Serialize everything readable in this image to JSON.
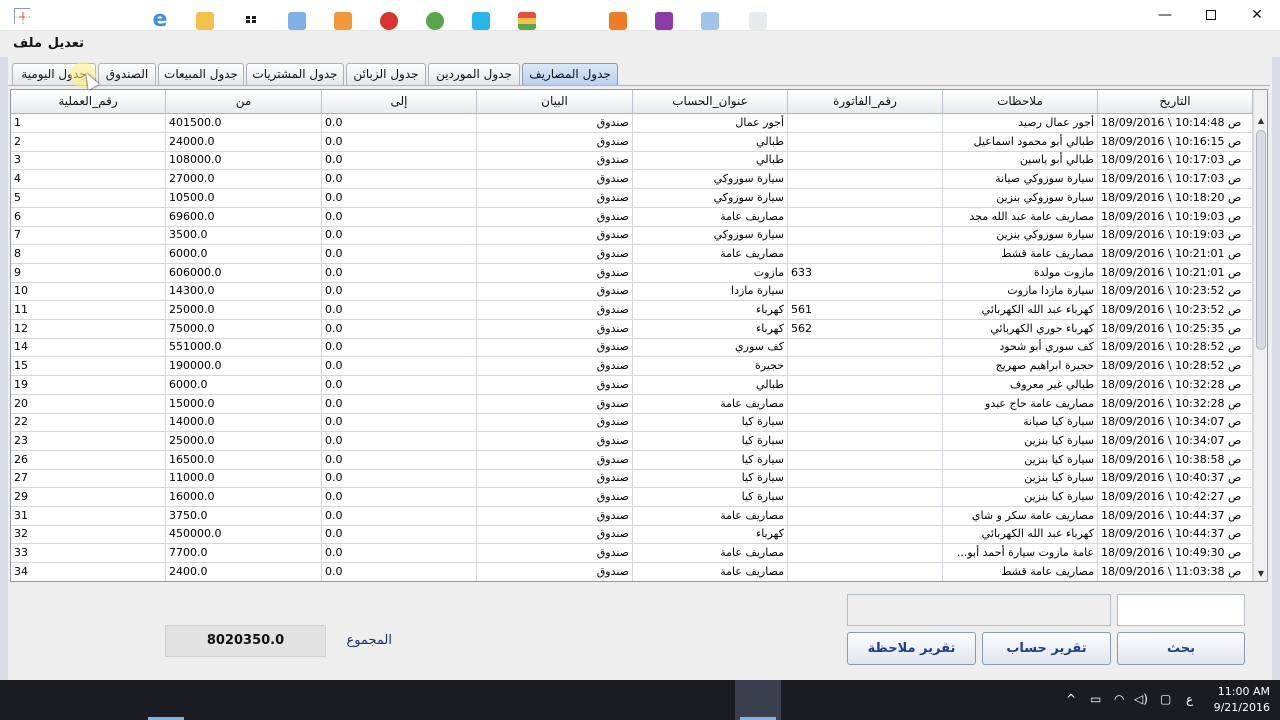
{
  "window": {
    "controls": {
      "minimize": "—",
      "maximize": "",
      "close": "✕"
    }
  },
  "menu": {
    "file": "ملف",
    "edit": "تعديل"
  },
  "tabs": [
    {
      "label": "جدول المصاريف",
      "active": true
    },
    {
      "label": "جدول الموردين",
      "active": false
    },
    {
      "label": "جدول الزبائن",
      "active": false
    },
    {
      "label": "جدول المشتريات",
      "active": false
    },
    {
      "label": "جدول المبيعات",
      "active": false
    },
    {
      "label": "الصندوق",
      "active": false
    },
    {
      "label": "جدول اليومية",
      "active": false
    }
  ],
  "table": {
    "columns": {
      "date": "التاريخ",
      "notes": "ملاحظات",
      "invoice": "رقم_الفاتورة",
      "account": "عنوان_الحساب",
      "statement": "البيان",
      "to": "إلى",
      "from": "من",
      "op": "رقم_العملية"
    },
    "rows": [
      {
        "date": "18/09/2016 \\ 10:14:48 ص",
        "notes": "أجور عمال رصيد",
        "invoice": "",
        "account": "أجور عمال",
        "statement": "صندوق",
        "to": "0.0",
        "from": "401500.0",
        "op": "1"
      },
      {
        "date": "18/09/2016 \\ 10:16:15 ص",
        "notes": "طبالي أبو محمود اسماعيل",
        "invoice": "",
        "account": "طبالي",
        "statement": "صندوق",
        "to": "0.0",
        "from": "24000.0",
        "op": "2"
      },
      {
        "date": "18/09/2016 \\ 10:17:03 ص",
        "notes": "طبالي أبو ياسين",
        "invoice": "",
        "account": "طبالي",
        "statement": "صندوق",
        "to": "0.0",
        "from": "108000.0",
        "op": "3"
      },
      {
        "date": "18/09/2016 \\ 10:17:03 ص",
        "notes": "سيارة سوزوكي صيانة",
        "invoice": "",
        "account": "سيارة سوزوكي",
        "statement": "صندوق",
        "to": "0.0",
        "from": "27000.0",
        "op": "4"
      },
      {
        "date": "18/09/2016 \\ 10:18:20 ص",
        "notes": "سيارة سوزوكي بنزين",
        "invoice": "",
        "account": "سيارة سوزوكي",
        "statement": "صندوق",
        "to": "0.0",
        "from": "10500.0",
        "op": "5"
      },
      {
        "date": "18/09/2016 \\ 10:19:03 ص",
        "notes": "مصاريف عامة عبد الله مجد",
        "invoice": "",
        "account": "مصاريف عامة",
        "statement": "صندوق",
        "to": "0.0",
        "from": "69600.0",
        "op": "6"
      },
      {
        "date": "18/09/2016 \\ 10:19:03 ص",
        "notes": "سيارة سوزوكي بنزين",
        "invoice": "",
        "account": "سيارة سوزوكي",
        "statement": "صندوق",
        "to": "0.0",
        "from": "3500.0",
        "op": "7"
      },
      {
        "date": "18/09/2016 \\ 10:21:01 ص",
        "notes": "مصاريف عامة قشط",
        "invoice": "",
        "account": "مصاريف عامة",
        "statement": "صندوق",
        "to": "0.0",
        "from": "6000.0",
        "op": "8"
      },
      {
        "date": "18/09/2016 \\ 10:21:01 ص",
        "notes": "مازوت مولدة",
        "invoice": "633",
        "account": "مازوت",
        "statement": "صندوق",
        "to": "0.0",
        "from": "606000.0",
        "op": "9"
      },
      {
        "date": "18/09/2016 \\ 10:23:52 ص",
        "notes": "سيارة مازدا مازوت",
        "invoice": "",
        "account": "سيارة مازدا",
        "statement": "صندوق",
        "to": "0.0",
        "from": "14300.0",
        "op": "10"
      },
      {
        "date": "18/09/2016 \\ 10:23:52 ص",
        "notes": "كهرباء عبد الله الكهربائي",
        "invoice": "561",
        "account": "كهرباء",
        "statement": "صندوق",
        "to": "0.0",
        "from": "25000.0",
        "op": "11"
      },
      {
        "date": "18/09/2016 \\ 10:25:35 ص",
        "notes": "كهرباء جوري الكهربائي",
        "invoice": "562",
        "account": "كهرباء",
        "statement": "صندوق",
        "to": "0.0",
        "from": "75000.0",
        "op": "12"
      },
      {
        "date": "18/09/2016 \\ 10:28:52 ص",
        "notes": "كف سوري أبو شحود",
        "invoice": "",
        "account": "كف سوري",
        "statement": "صندوق",
        "to": "0.0",
        "from": "551000.0",
        "op": "14"
      },
      {
        "date": "18/09/2016 \\ 10:28:52 ص",
        "notes": "حجيرة ابراهيم صهريج",
        "invoice": "",
        "account": "حجيرة",
        "statement": "صندوق",
        "to": "0.0",
        "from": "190000.0",
        "op": "15"
      },
      {
        "date": "18/09/2016 \\ 10:32:28 ص",
        "notes": "طبالي غير معروف",
        "invoice": "",
        "account": "طبالي",
        "statement": "صندوق",
        "to": "0.0",
        "from": "6000.0",
        "op": "19"
      },
      {
        "date": "18/09/2016 \\ 10:32:28 ص",
        "notes": "مصاريف عامة حاج عبدو",
        "invoice": "",
        "account": "مصاريف عامة",
        "statement": "صندوق",
        "to": "0.0",
        "from": "15000.0",
        "op": "20"
      },
      {
        "date": "18/09/2016 \\ 10:34:07 ص",
        "notes": "سيارة كيا صيانة",
        "invoice": "",
        "account": "سيارة كيا",
        "statement": "صندوق",
        "to": "0.0",
        "from": "14000.0",
        "op": "22"
      },
      {
        "date": "18/09/2016 \\ 10:34:07 ص",
        "notes": "سيارة كيا بنزين",
        "invoice": "",
        "account": "سيارة كيا",
        "statement": "صندوق",
        "to": "0.0",
        "from": "25000.0",
        "op": "23"
      },
      {
        "date": "18/09/2016 \\ 10:38:58 ص",
        "notes": "سيارة كيا بنزين",
        "invoice": "",
        "account": "سيارة كيا",
        "statement": "صندوق",
        "to": "0.0",
        "from": "16500.0",
        "op": "26"
      },
      {
        "date": "18/09/2016 \\ 10:40:37 ص",
        "notes": "سيارة كيا بنزين",
        "invoice": "",
        "account": "سيارة كيا",
        "statement": "صندوق",
        "to": "0.0",
        "from": "11000.0",
        "op": "27"
      },
      {
        "date": "18/09/2016 \\ 10:42:27 ص",
        "notes": "سيارة كيا بنزين",
        "invoice": "",
        "account": "سيارة كيا",
        "statement": "صندوق",
        "to": "0.0",
        "from": "16000.0",
        "op": "29"
      },
      {
        "date": "18/09/2016 \\ 10:44:37 ص",
        "notes": "مصاريف عامة سكر و شاي",
        "invoice": "",
        "account": "مصاريف عامة",
        "statement": "صندوق",
        "to": "0.0",
        "from": "3750.0",
        "op": "31"
      },
      {
        "date": "18/09/2016 \\ 10:44:37 ص",
        "notes": "كهرباء عبد الله الكهربائي",
        "invoice": "",
        "account": "كهرباء",
        "statement": "صندوق",
        "to": "0.0",
        "from": "450000.0",
        "op": "32"
      },
      {
        "date": "18/09/2016 \\ 10:49:30 ص",
        "notes": "عامة مازوت سيارة أحمد أبو...",
        "invoice": "",
        "account": "مصاريف عامة",
        "statement": "صندوق",
        "to": "0.0",
        "from": "7700.0",
        "op": "33"
      },
      {
        "date": "18/09/2016 \\ 11:03:38 ص",
        "notes": "مصاريف عامة قشط",
        "invoice": "",
        "account": "مصاريف عامة",
        "statement": "صندوق",
        "to": "0.0",
        "from": "2400.0",
        "op": "34"
      }
    ]
  },
  "scrollbar": {
    "up": "▲",
    "down": "▼"
  },
  "buttons": {
    "search": "بحث",
    "account_report": "تقرير حساب",
    "note_report": "تقرير ملاحظة"
  },
  "total": {
    "label": "المجموع",
    "value": "8020350.0"
  },
  "taskbar": {
    "icons": [
      "windows-start",
      "search",
      "task-view",
      "edge",
      "file-explorer",
      "store",
      "app-cube",
      "app-orange",
      "app-red",
      "app-green",
      "app-cyan",
      "app-stack",
      "calculator",
      "app-orange-square",
      "app-purple",
      "app-blue-monitor",
      "java-app"
    ],
    "tray": {
      "chevron": "^",
      "lang": "ع"
    },
    "time": "11:00 AM",
    "date": "9/21/2016"
  }
}
